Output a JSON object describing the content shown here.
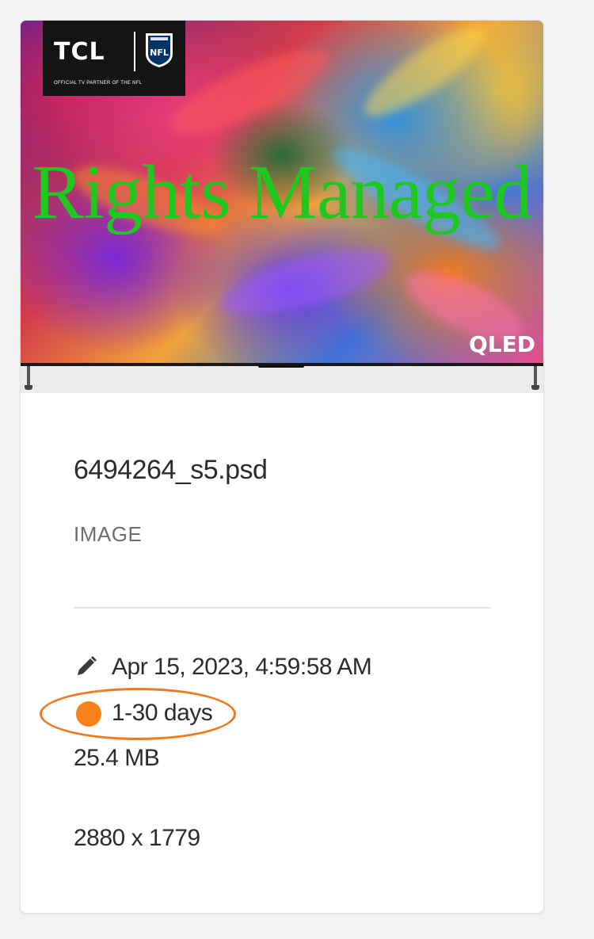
{
  "asset": {
    "preview": {
      "logo_brand": "TCL",
      "logo_tagline": "OFFICIAL TV PARTNER OF THE NFL",
      "nfl_mark": "NFL",
      "watermark": "Rights Managed",
      "badge": "QLED"
    },
    "filename": "6494264_s5.psd",
    "type": "IMAGE",
    "modified": "Apr 15, 2023, 4:59:58 AM",
    "modified_icon": "pencil-icon",
    "expiry": {
      "label": "1-30 days",
      "color": "#f7821b",
      "highlight_color": "#f07a1f"
    },
    "filesize": "25.4 MB",
    "dimensions": "2880 x 1779"
  },
  "colors": {
    "watermark": "#1ec81e",
    "text_primary": "#2c2c2c",
    "text_secondary": "#6e6e6e",
    "card_background": "#ffffff",
    "page_background": "#f3f3f3"
  }
}
